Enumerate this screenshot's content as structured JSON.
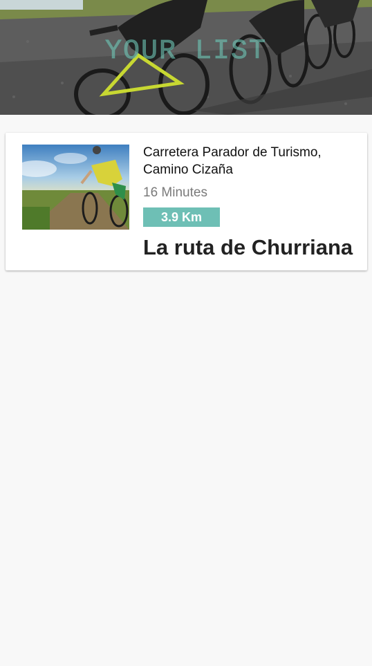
{
  "header": {
    "title": "YOUR LIST",
    "background_icon": "cyclists-banner-image"
  },
  "routes": [
    {
      "thumbnail_icon": "cyclist-photo",
      "address": "Carretera Parador de Turismo, Camino Cizaña",
      "duration": "16 Minutes",
      "distance": "3.9 Km",
      "name": "La ruta de Churriana"
    }
  ],
  "colors": {
    "accent": "#6ebfb5",
    "background": "#f8f8f8",
    "card": "#ffffff"
  }
}
